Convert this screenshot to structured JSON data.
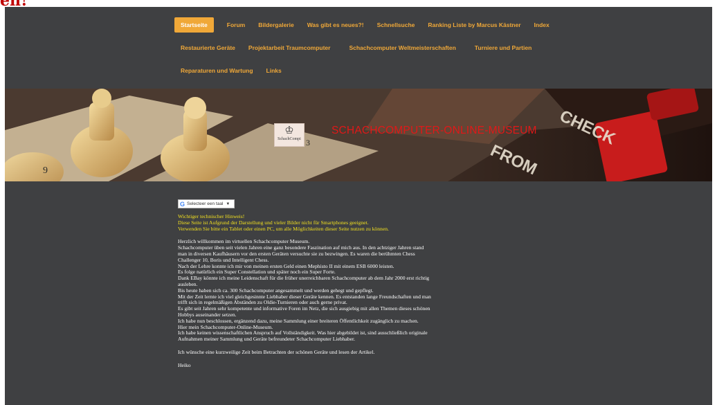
{
  "page_fragment": "en!",
  "nav": {
    "rows": [
      [
        {
          "label": "Startseite",
          "active": true
        },
        {
          "label": "Forum"
        },
        {
          "label": "Bildergalerie"
        },
        {
          "label": "Was gibt es neues?!"
        },
        {
          "label": "Schnellsuche"
        },
        {
          "label": "Ranking Liste by Marcus Kästner"
        },
        {
          "label": "Index"
        }
      ],
      [
        {
          "label": "Restaurierte Geräte"
        },
        {
          "label": "Projektarbeit Traumcomputer"
        },
        {
          "label": "Schachcomputer Weltmeisterschaften"
        },
        {
          "label": "Turniere und Partien"
        }
      ],
      [
        {
          "label": "Reparaturen und Wartung"
        },
        {
          "label": "Links"
        }
      ]
    ]
  },
  "banner": {
    "logo_text": "SchachCompi",
    "title": "SCHACHCOMPUTER-ONLINE-MUSEUM"
  },
  "language_selector": {
    "label": "Selecteer een taal",
    "icon": "google-g-icon"
  },
  "warning": {
    "line1": "Wichtiger technischer Hinweis!",
    "line2": "Diese Seite ist Aufgrund der Darstellung und vieler Bilder nicht für Smartphones geeignet.",
    "line3": "Verwenden Sie bitte ein Tablet oder einen PC, um alle Möglichkeiten dieser Seite nutzen zu können."
  },
  "intro": {
    "l1": "Herzlich willkommen im virtuellen Schachcomputer Museum.",
    "l2": "Schachcomputer üben seit vielen Jahren eine ganz besondere Faszination auf mich aus. In den achtziger Jahren stand man in diversen Kaufhäusern vor den ersten Geräten versuchte sie zu bezwingen. Es waren die berühmten Chess Challenger 10, Boris und Intelligent Chess.",
    "l3": "Nach der Lehre konnte ich mir von meinen ersten Geld einen Mephisto II mit einem ESB 6000 leisten.",
    "l4": "Es folge natürlich ein Super Constellation und später noch ein Super Forte.",
    "l5": "Dank EBay könnte ich meine Leidenschaft für die früher unerreichbaren Schachcomputer ab dem Jahr 2000 erst richtig ausleben.",
    "l6": "Bis heute haben sich ca. 300 Schachcomputer angesammelt und werden gehegt und gepflegt.",
    "l7": "Mit der Zeit lernte ich viel gleichgesinnte Liebhaber dieser Geräte kennen. Es entstanden lange Freundschaften und man trifft sich in regelmäßigen Abständen zu Oldie-Turnieren oder auch gerne privat.",
    "l8": "Es gibt seit Jahren sehr kompetente und informative Foren im Netz, die sich ausgiebig mit allen Themen dieses schönen Hobbys auseinander setzen.",
    "l9": "Ich habe nun beschlossen, ergänzend dazu, meine Sammlung einer breiteren Öffentlichkeit zugänglich zu machen.",
    "l10": "Hier mein Schachcomputer-Online-Museum.",
    "l11": "Ich habe keinen wissenschaftlichen Anspruch auf Vollständigkeit. Was hier abgebildet ist, sind ausschließlich originale Aufnahmen meiner Sammlung und Geräte befreundeter Schachcomputer Liebhaber."
  },
  "closing": "Ich wünsche eine kurzweilige Zeit beim Betrachten der schönen Geräte und lesen der Artikel.",
  "signature": "Heiko",
  "colors": {
    "background": "#3f4042",
    "accent": "#f0a838",
    "title_red": "#e01818",
    "warning_yellow": "#f2e020"
  }
}
